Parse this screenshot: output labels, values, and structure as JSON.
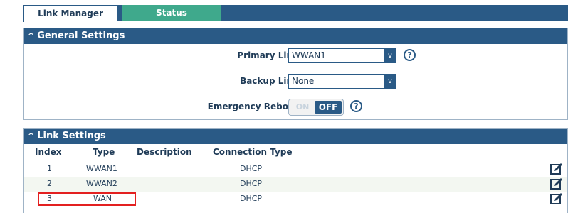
{
  "tabs": [
    {
      "label": "Link Manager",
      "active": true
    },
    {
      "label": "Status",
      "active": false
    }
  ],
  "general": {
    "header": "General Settings",
    "primary_label": "Primary Link",
    "primary_value": "WWAN1",
    "backup_label": "Backup Link",
    "backup_value": "None",
    "emergency_label": "Emergency Reboot",
    "toggle_on": "ON",
    "toggle_off": "OFF",
    "toggle_state": "off",
    "help_glyph": "?"
  },
  "link": {
    "header": "Link Settings",
    "columns": [
      "Index",
      "Type",
      "Description",
      "Connection Type"
    ],
    "rows": [
      {
        "index": "1",
        "type": "WWAN1",
        "description": "",
        "connection": "DHCP"
      },
      {
        "index": "2",
        "type": "WWAN2",
        "description": "",
        "connection": "DHCP"
      },
      {
        "index": "3",
        "type": "WAN",
        "description": "",
        "connection": "DHCP"
      }
    ]
  },
  "select_arrow": "v",
  "colors": {
    "primary": "#2a5a86",
    "tab_inactive": "#3fa98c",
    "highlight": "#e32020",
    "row_alt": "#f3f7f1"
  },
  "icons": [
    "caret-up-icon",
    "dropdown-arrow-icon",
    "help-icon",
    "edit-icon"
  ]
}
